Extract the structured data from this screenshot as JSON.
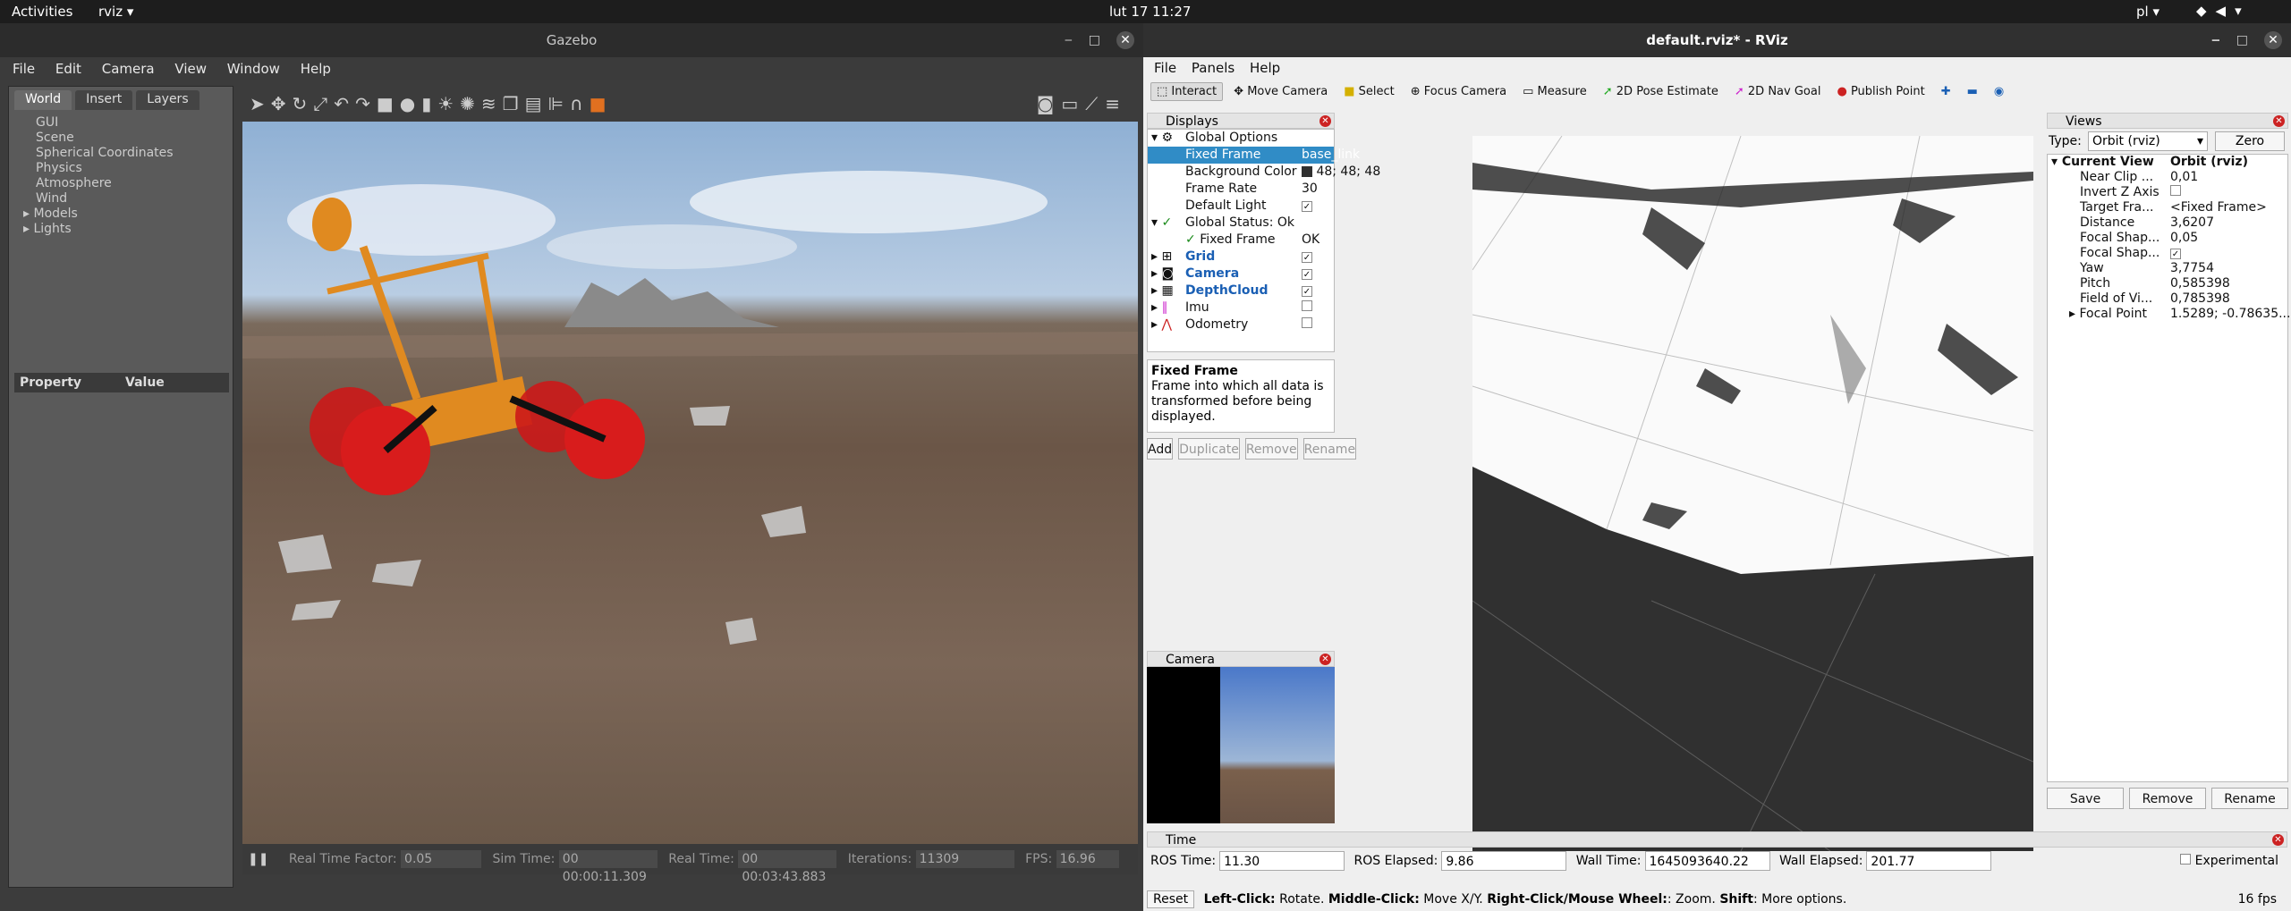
{
  "topbar": {
    "activities": "Activities",
    "app": "rviz ▾",
    "clock": "lut 17  11:27",
    "lang": "pl ▾"
  },
  "gazebo": {
    "title": "Gazebo",
    "menu": [
      "File",
      "Edit",
      "Camera",
      "View",
      "Window",
      "Help"
    ],
    "tabs": [
      "World",
      "Insert",
      "Layers"
    ],
    "tree": [
      "GUI",
      "Scene",
      "Spherical Coordinates",
      "Physics",
      "Atmosphere",
      "Wind",
      "Models",
      "Lights"
    ],
    "prop_header": {
      "property": "Property",
      "value": "Value"
    },
    "status": {
      "rtf_label": "Real Time Factor:",
      "rtf": "0.05",
      "sim_label": "Sim Time:",
      "sim": "00 00:00:11.309",
      "real_label": "Real Time:",
      "real": "00 00:03:43.883",
      "iter_label": "Iterations:",
      "iter": "11309",
      "fps_label": "FPS:",
      "fps": "16.96"
    }
  },
  "rviz": {
    "title": "default.rviz* - RViz",
    "menu": [
      "File",
      "Panels",
      "Help"
    ],
    "tools": [
      "Interact",
      "Move Camera",
      "Select",
      "Focus Camera",
      "Measure",
      "2D Pose Estimate",
      "2D Nav Goal",
      "Publish Point"
    ],
    "displays": {
      "title": "Displays",
      "rows": [
        {
          "k": "Global Options"
        },
        {
          "k": "Fixed Frame",
          "v": "base_link"
        },
        {
          "k": "Background Color",
          "v": "48; 48; 48"
        },
        {
          "k": "Frame Rate",
          "v": "30"
        },
        {
          "k": "Default Light"
        },
        {
          "k": "Global Status: Ok"
        },
        {
          "k": "Fixed Frame",
          "v": "OK"
        },
        {
          "k": "Grid"
        },
        {
          "k": "Camera"
        },
        {
          "k": "DepthCloud"
        },
        {
          "k": "Imu"
        },
        {
          "k": "Odometry"
        }
      ],
      "desc_title": "Fixed Frame",
      "desc_text": "Frame into which all data is transformed before being displayed.",
      "buttons": [
        "Add",
        "Duplicate",
        "Remove",
        "Rename"
      ]
    },
    "camera_panel": "Camera",
    "views": {
      "title": "Views",
      "type_label": "Type:",
      "type_value": "Orbit (rviz)",
      "zero": "Zero",
      "rows": [
        {
          "k": "Current View",
          "v": "Orbit (rviz)"
        },
        {
          "k": "Near Clip ...",
          "v": "0,01"
        },
        {
          "k": "Invert Z Axis",
          "v": ""
        },
        {
          "k": "Target Fra...",
          "v": "<Fixed Frame>"
        },
        {
          "k": "Distance",
          "v": "3,6207"
        },
        {
          "k": "Focal Shap...",
          "v": "0,05"
        },
        {
          "k": "Focal Shap...",
          "v": ""
        },
        {
          "k": "Yaw",
          "v": "3,7754"
        },
        {
          "k": "Pitch",
          "v": "0,585398"
        },
        {
          "k": "Field of Vi...",
          "v": "0,785398"
        },
        {
          "k": "Focal Point",
          "v": "1.5289; -0.78635..."
        }
      ],
      "buttons": [
        "Save",
        "Remove",
        "Rename"
      ]
    },
    "time": {
      "title": "Time",
      "ros_time_label": "ROS Time:",
      "ros_time": "11.30",
      "ros_elapsed_label": "ROS Elapsed:",
      "ros_elapsed": "9.86",
      "wall_time_label": "Wall Time:",
      "wall_time": "1645093640.22",
      "wall_elapsed_label": "Wall Elapsed:",
      "wall_elapsed": "201.77",
      "experimental": "Experimental"
    },
    "status": {
      "reset": "Reset",
      "hint_b1": "Left-Click:",
      "hint_t1": " Rotate. ",
      "hint_b2": "Middle-Click:",
      "hint_t2": " Move X/Y. ",
      "hint_b3": "Right-Click/Mouse Wheel:",
      "hint_t3": ": Zoom. ",
      "hint_b4": "Shift",
      "hint_t4": ": More options.",
      "fps": "16 fps"
    }
  }
}
